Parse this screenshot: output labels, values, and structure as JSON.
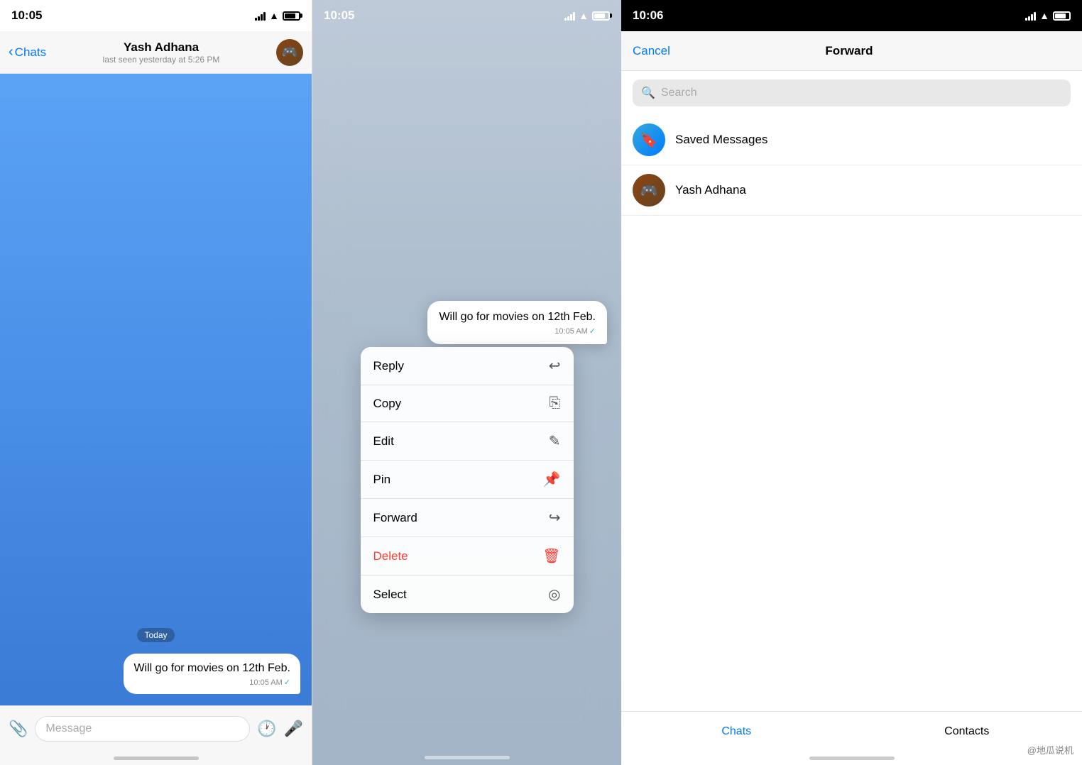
{
  "panel1": {
    "status_time": "10:05",
    "header": {
      "back_label": "Chats",
      "contact_name": "Yash Adhana",
      "contact_status": "last seen yesterday at 5:26 PM",
      "avatar_emoji": "🎮"
    },
    "messages": [
      {
        "text": "Will go for movies on 12th Feb.",
        "time": "10:05 AM",
        "check": "✓"
      }
    ],
    "date_badge": "Today",
    "input_placeholder": "Message"
  },
  "panel2": {
    "status_time": "10:05",
    "message": {
      "text": "Will go for movies on 12th Feb.",
      "time": "10:05 AM",
      "check": "✓"
    },
    "context_menu": [
      {
        "label": "Reply",
        "icon": "↩",
        "color": "normal"
      },
      {
        "label": "Copy",
        "icon": "⎘",
        "color": "normal"
      },
      {
        "label": "Edit",
        "icon": "✏",
        "color": "normal"
      },
      {
        "label": "Pin",
        "icon": "📌",
        "color": "normal"
      },
      {
        "label": "Forward",
        "icon": "↗",
        "color": "normal"
      },
      {
        "label": "Delete",
        "icon": "🗑",
        "color": "delete"
      },
      {
        "label": "Select",
        "icon": "◎",
        "color": "normal"
      }
    ]
  },
  "panel3": {
    "status_time": "10:06",
    "header": {
      "cancel_label": "Cancel",
      "title": "Forward"
    },
    "search_placeholder": "Search",
    "contacts": [
      {
        "name": "Saved Messages",
        "type": "saved",
        "icon": "🔖"
      },
      {
        "name": "Yash Adhana",
        "type": "yash",
        "icon": "🎮"
      }
    ],
    "tabs": [
      {
        "label": "Chats",
        "active": true
      },
      {
        "label": "Contacts",
        "active": false
      }
    ],
    "watermark": "@地瓜说机"
  }
}
